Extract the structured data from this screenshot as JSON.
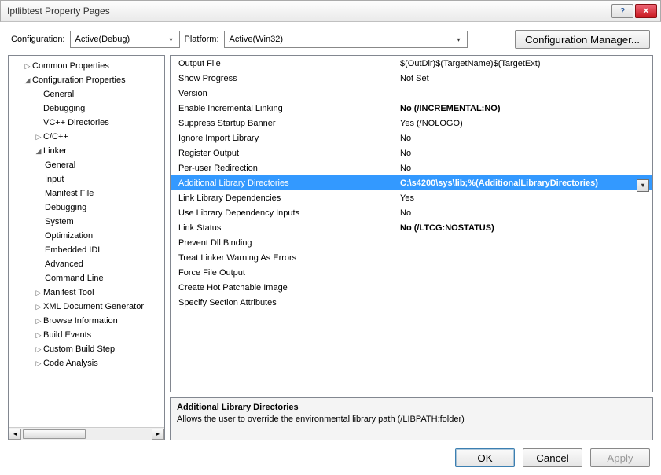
{
  "window": {
    "title": "Iptlibtest Property Pages"
  },
  "config_row": {
    "config_label": "Configuration:",
    "config_value": "Active(Debug)",
    "platform_label": "Platform:",
    "platform_value": "Active(Win32)",
    "manager_button": "Configuration Manager..."
  },
  "tree": {
    "common_properties": "Common Properties",
    "configuration_properties": "Configuration Properties",
    "general": "General",
    "debugging": "Debugging",
    "vcpp_directories": "VC++ Directories",
    "ccpp": "C/C++",
    "linker": "Linker",
    "linker_general": "General",
    "linker_input": "Input",
    "linker_manifest_file": "Manifest File",
    "linker_debugging": "Debugging",
    "linker_system": "System",
    "linker_optimization": "Optimization",
    "linker_embedded_idl": "Embedded IDL",
    "linker_advanced": "Advanced",
    "linker_command_line": "Command Line",
    "manifest_tool": "Manifest Tool",
    "xml_doc_generator": "XML Document Generator",
    "browse_information": "Browse Information",
    "build_events": "Build Events",
    "custom_build_step": "Custom Build Step",
    "code_analysis": "Code Analysis"
  },
  "props": [
    {
      "name": "Output File",
      "value": "$(OutDir)$(TargetName)$(TargetExt)",
      "bold": false
    },
    {
      "name": "Show Progress",
      "value": "Not Set",
      "bold": false
    },
    {
      "name": "Version",
      "value": "",
      "bold": false
    },
    {
      "name": "Enable Incremental Linking",
      "value": "No (/INCREMENTAL:NO)",
      "bold": true
    },
    {
      "name": "Suppress Startup Banner",
      "value": "Yes (/NOLOGO)",
      "bold": false
    },
    {
      "name": "Ignore Import Library",
      "value": "No",
      "bold": false
    },
    {
      "name": "Register Output",
      "value": "No",
      "bold": false
    },
    {
      "name": "Per-user Redirection",
      "value": "No",
      "bold": false
    },
    {
      "name": "Additional Library Directories",
      "value": "C:\\s4200\\sys\\lib;%(AdditionalLibraryDirectories)",
      "bold": true,
      "selected": true
    },
    {
      "name": "Link Library Dependencies",
      "value": "Yes",
      "bold": false
    },
    {
      "name": "Use Library Dependency Inputs",
      "value": "No",
      "bold": false
    },
    {
      "name": "Link Status",
      "value": "No (/LTCG:NOSTATUS)",
      "bold": true
    },
    {
      "name": "Prevent Dll Binding",
      "value": "",
      "bold": false
    },
    {
      "name": "Treat Linker Warning As Errors",
      "value": "",
      "bold": false
    },
    {
      "name": "Force File Output",
      "value": "",
      "bold": false
    },
    {
      "name": "Create Hot Patchable Image",
      "value": "",
      "bold": false
    },
    {
      "name": "Specify Section Attributes",
      "value": "",
      "bold": false
    }
  ],
  "description": {
    "title": "Additional Library Directories",
    "body": "Allows the user to override the environmental library path (/LIBPATH:folder)"
  },
  "buttons": {
    "ok": "OK",
    "cancel": "Cancel",
    "apply": "Apply"
  }
}
